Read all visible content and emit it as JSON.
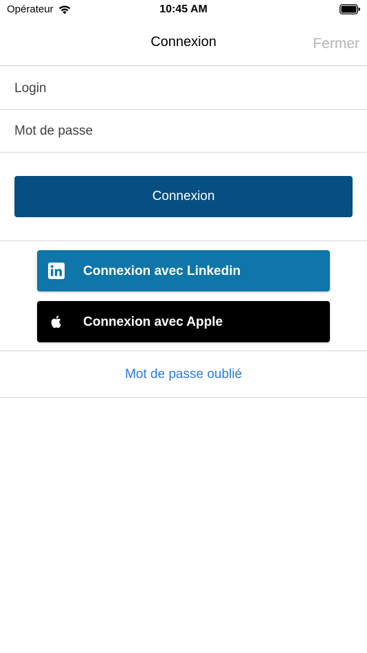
{
  "status_bar": {
    "carrier": "Opérateur",
    "time": "10:45 AM"
  },
  "nav": {
    "title": "Connexion",
    "close_label": "Fermer"
  },
  "form": {
    "login_placeholder": "Login",
    "login_value": "",
    "password_placeholder": "Mot de passe",
    "password_value": "",
    "submit_label": "Connexion"
  },
  "social": {
    "linkedin_label": "Connexion avec Linkedin",
    "linkedin_icon": "linkedin-icon",
    "apple_label": "Connexion avec Apple",
    "apple_icon": "apple-icon"
  },
  "forgot_password_label": "Mot de passe oublié",
  "colors": {
    "primary": "#064f82",
    "linkedin": "#0e76a8",
    "apple": "#000000",
    "link": "#2c7be5",
    "close_text": "#b5b5b5"
  }
}
